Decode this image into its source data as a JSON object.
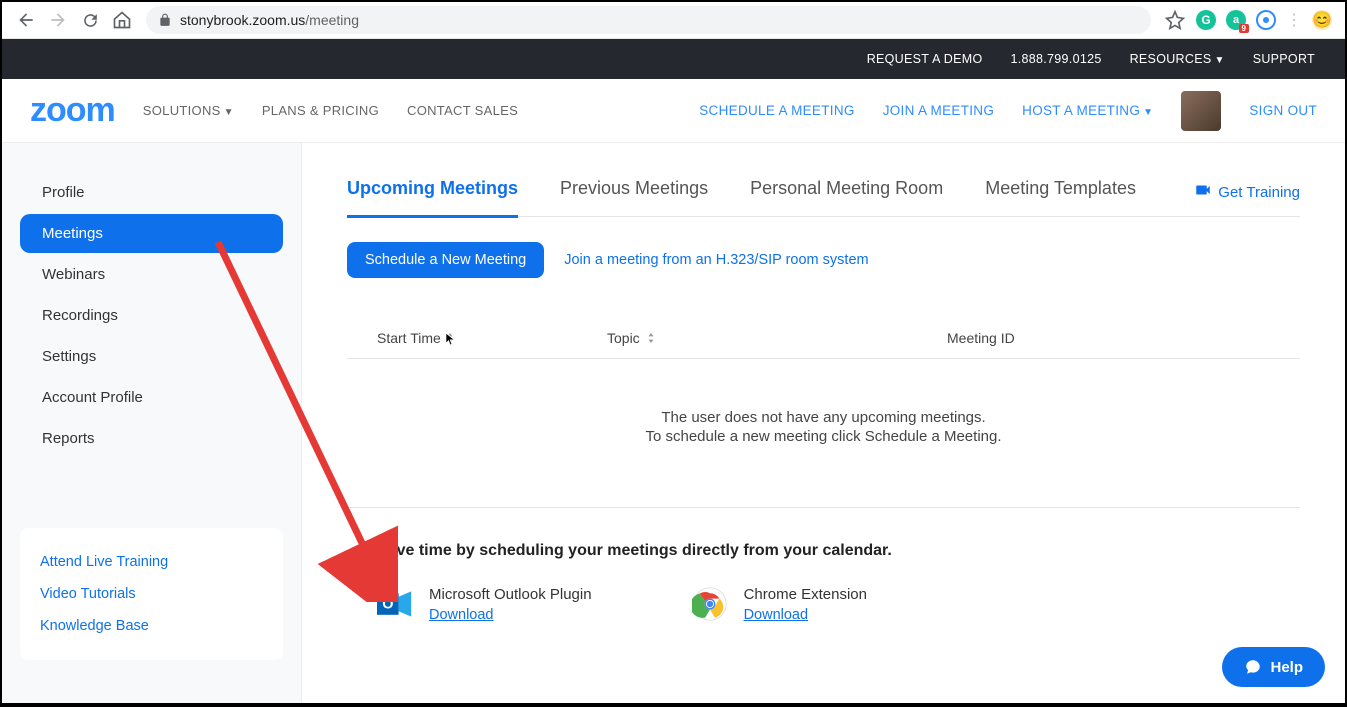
{
  "browser": {
    "url_domain": "stonybrook.zoom.us",
    "url_path": "/meeting"
  },
  "topbar": {
    "demo": "REQUEST A DEMO",
    "phone": "1.888.799.0125",
    "resources": "RESOURCES",
    "support": "SUPPORT"
  },
  "header": {
    "logo": "zoom",
    "nav": {
      "solutions": "SOLUTIONS",
      "plans": "PLANS & PRICING",
      "contact": "CONTACT SALES"
    },
    "right": {
      "schedule": "SCHEDULE A MEETING",
      "join": "JOIN A MEETING",
      "host": "HOST A MEETING",
      "signout": "SIGN OUT"
    }
  },
  "sidebar": {
    "items": [
      "Profile",
      "Meetings",
      "Webinars",
      "Recordings",
      "Settings",
      "Account Profile",
      "Reports"
    ],
    "card": {
      "training": "Attend Live Training",
      "tutorials": "Video Tutorials",
      "kb": "Knowledge Base"
    }
  },
  "tabs": {
    "upcoming": "Upcoming Meetings",
    "previous": "Previous Meetings",
    "personal": "Personal Meeting Room",
    "templates": "Meeting Templates",
    "get_training": "Get Training"
  },
  "actions": {
    "schedule": "Schedule a New Meeting",
    "sip": "Join a meeting from an H.323/SIP room system"
  },
  "table": {
    "start": "Start Time",
    "topic": "Topic",
    "meeting_id": "Meeting ID"
  },
  "empty": {
    "l1": "The user does not have any upcoming meetings.",
    "l2": "To schedule a new meeting click Schedule a Meeting."
  },
  "savetime": {
    "heading": "Save time by scheduling your meetings directly from your calendar.",
    "outlook": "Microsoft Outlook Plugin",
    "chrome": "Chrome Extension",
    "download": "Download"
  },
  "help": "Help"
}
